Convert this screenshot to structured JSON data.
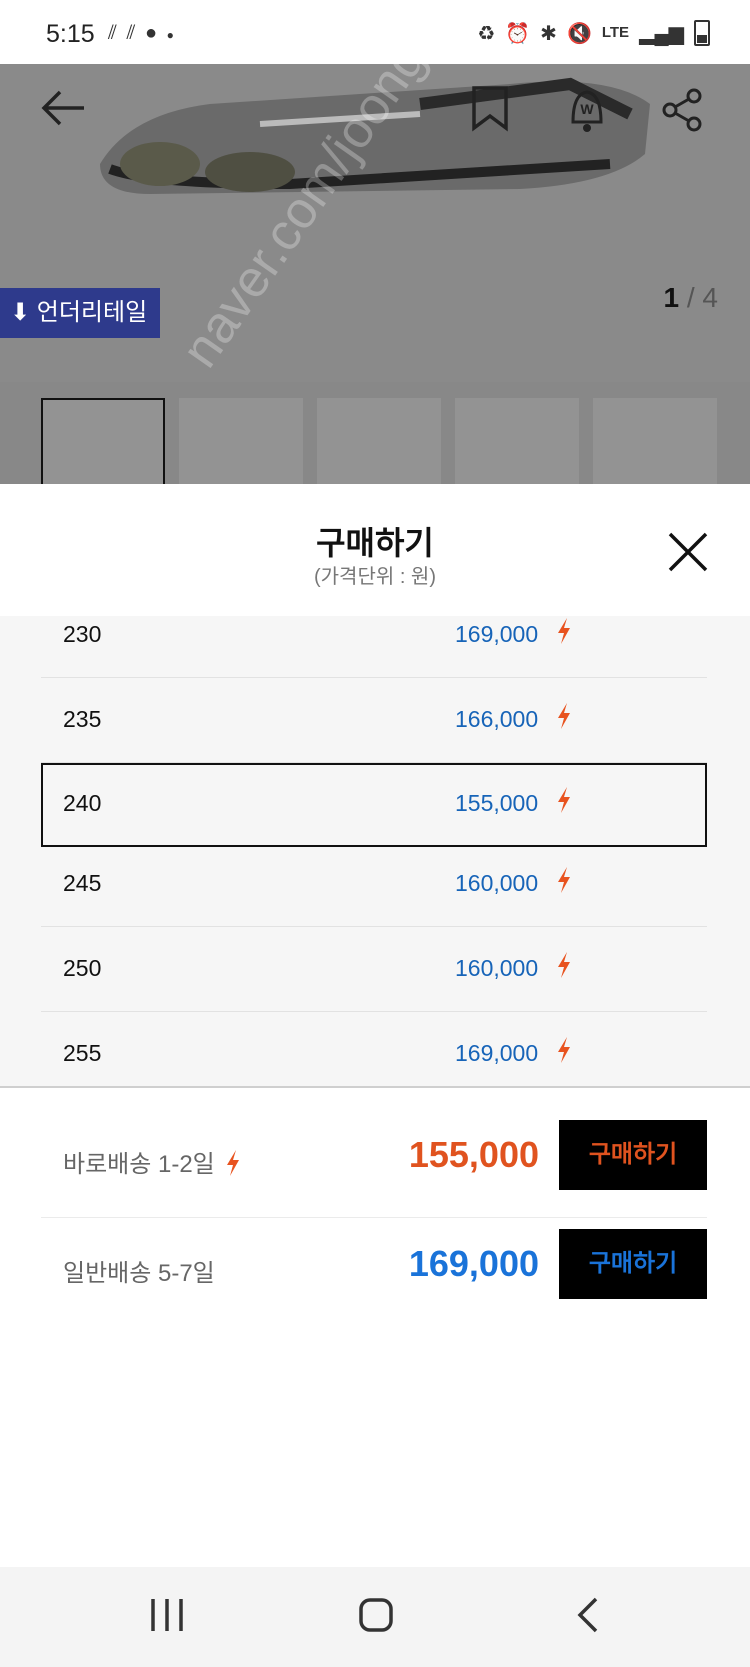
{
  "status_bar": {
    "time": "5:15",
    "left_icons": [
      "signal-slash-icon",
      "signal-slash-icon",
      "app-icon",
      "dot-icon"
    ],
    "right_icons": [
      "recycle-icon",
      "alarm-icon",
      "bluetooth-icon",
      "mute-icon",
      "lte-icon",
      "signal-icon",
      "battery-icon"
    ],
    "network": "LTE"
  },
  "product": {
    "underdetail_label": "⬇ 언더리테일",
    "image_counter": {
      "current": "1",
      "separator": " / ",
      "total": "4"
    },
    "watermark": "naver.com/joonggonara",
    "thumbnails": [
      "thumb-1",
      "thumb-2",
      "thumb-3",
      "thumb-4",
      "thumb-5"
    ]
  },
  "sheet": {
    "title": "구매하기",
    "subtitle": "(가격단위 : 원)"
  },
  "sizes": [
    {
      "size": "230",
      "price": "169,000"
    },
    {
      "size": "235",
      "price": "166,000"
    },
    {
      "size": "240",
      "price": "155,000",
      "selected": true
    },
    {
      "size": "245",
      "price": "160,000"
    },
    {
      "size": "250",
      "price": "160,000"
    },
    {
      "size": "255",
      "price": "169,000"
    }
  ],
  "purchase_options": [
    {
      "shipping": "바로배송 1-2일",
      "price": "155,000",
      "button": "구매하기",
      "color": "#e0531f",
      "express": true
    },
    {
      "shipping": "일반배송 5-7일",
      "price": "169,000",
      "button": "구매하기",
      "color": "#1a73d9",
      "express": false
    }
  ],
  "colors": {
    "price_blue": "#1764b8",
    "bolt": "#e8531f",
    "underdetail_bg": "#2e3a8c"
  }
}
